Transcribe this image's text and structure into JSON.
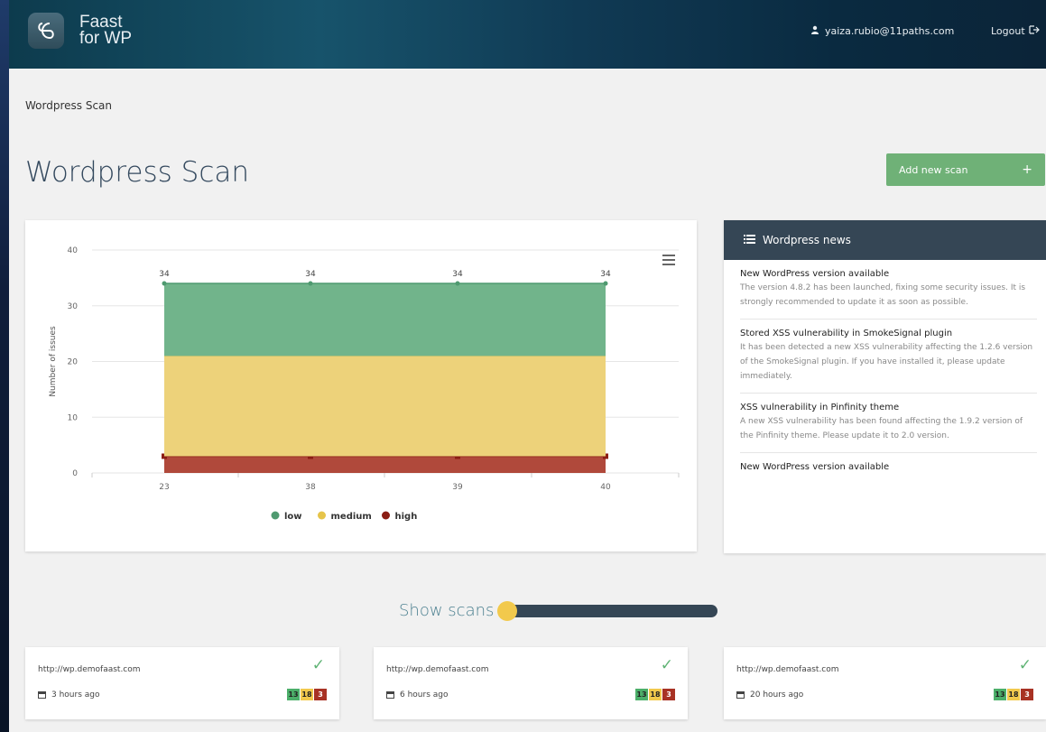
{
  "header": {
    "app_name_line1": "Faast",
    "app_name_line2": "for WP",
    "user_email": "yaiza.rubio@11paths.com",
    "logout_label": "Logout"
  },
  "breadcrumb": "Wordpress Scan",
  "page_title": "Wordpress Scan",
  "add_button": {
    "label": "Add new scan",
    "icon": "+"
  },
  "chart_data": {
    "type": "area",
    "stacked": true,
    "x": [
      "23",
      "38",
      "39",
      "40"
    ],
    "ylabel": "Number of issues",
    "ylim": [
      0,
      40
    ],
    "yticks": [
      0,
      10,
      20,
      30,
      40
    ],
    "series": [
      {
        "name": "high",
        "color": "#b0493b",
        "values": [
          3,
          3,
          3,
          3
        ]
      },
      {
        "name": "medium",
        "color": "#edd27a",
        "values": [
          18,
          18,
          18,
          18
        ]
      },
      {
        "name": "low",
        "color": "#71b48b",
        "values": [
          13,
          13,
          13,
          13
        ]
      }
    ],
    "totals": [
      34,
      34,
      34,
      34
    ],
    "legend": [
      {
        "name": "low",
        "color": "#4f9a70"
      },
      {
        "name": "medium",
        "color": "#e6c44a"
      },
      {
        "name": "high",
        "color": "#8b1d14"
      }
    ],
    "legend_position": "bottom-center"
  },
  "news": {
    "title": "Wordpress news",
    "items": [
      {
        "title": "New WordPress version available",
        "body": "The version 4.8.2 has been launched, fixing some security issues. It is strongly recommended to update it as soon as possible."
      },
      {
        "title": "Stored XSS vulnerability in SmokeSignal plugin",
        "body": "It has been detected a new XSS vulnerability affecting the 1.2.6 version of the SmokeSignal plugin. If you have installed it, please update immediately."
      },
      {
        "title": "XSS vulnerability in Pinfinity theme",
        "body": "A new XSS vulnerability has been found affecting the 1.9.2 version of the Pinfinity theme. Please update it to 2.0 version."
      },
      {
        "title": "New WordPress version available",
        "body": ""
      }
    ]
  },
  "show_scans_label": "Show scans",
  "scans": [
    {
      "url": "http://wp.demofaast.com",
      "time": "3 hours ago",
      "low": "13",
      "medium": "18",
      "high": "3"
    },
    {
      "url": "http://wp.demofaast.com",
      "time": "6 hours ago",
      "low": "13",
      "medium": "18",
      "high": "3"
    },
    {
      "url": "http://wp.demofaast.com",
      "time": "20 hours ago",
      "low": "13",
      "medium": "18",
      "high": "3"
    }
  ]
}
